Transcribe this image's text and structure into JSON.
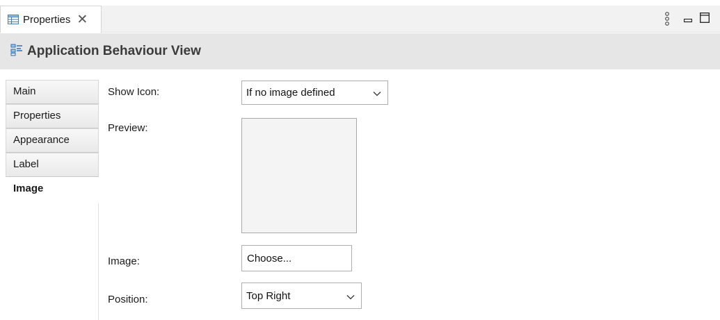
{
  "view_tab": {
    "label": "Properties",
    "close_symbol": "✕"
  },
  "toolbar": {
    "menu_icon": "view-menu-icon",
    "minimize_icon": "minimize-icon",
    "maximize_icon": "maximize-icon"
  },
  "header": {
    "title": "Application Behaviour View",
    "icon": "application-view-icon"
  },
  "sections": {
    "items": [
      {
        "label": "Main",
        "active": false
      },
      {
        "label": "Properties",
        "active": false
      },
      {
        "label": "Appearance",
        "active": false
      },
      {
        "label": "Label",
        "active": false
      },
      {
        "label": "Image",
        "active": true
      }
    ]
  },
  "form": {
    "show_icon_label": "Show Icon:",
    "show_icon_value": "If no image defined",
    "preview_label": "Preview:",
    "image_label": "Image:",
    "choose_button": "Choose...",
    "position_label": "Position:",
    "position_value": "Top Right"
  },
  "colors": {
    "header_bg": "#e6e6e6",
    "tabbar_bg": "#f2f2f2",
    "icon_blue": "#2f6fb3"
  }
}
